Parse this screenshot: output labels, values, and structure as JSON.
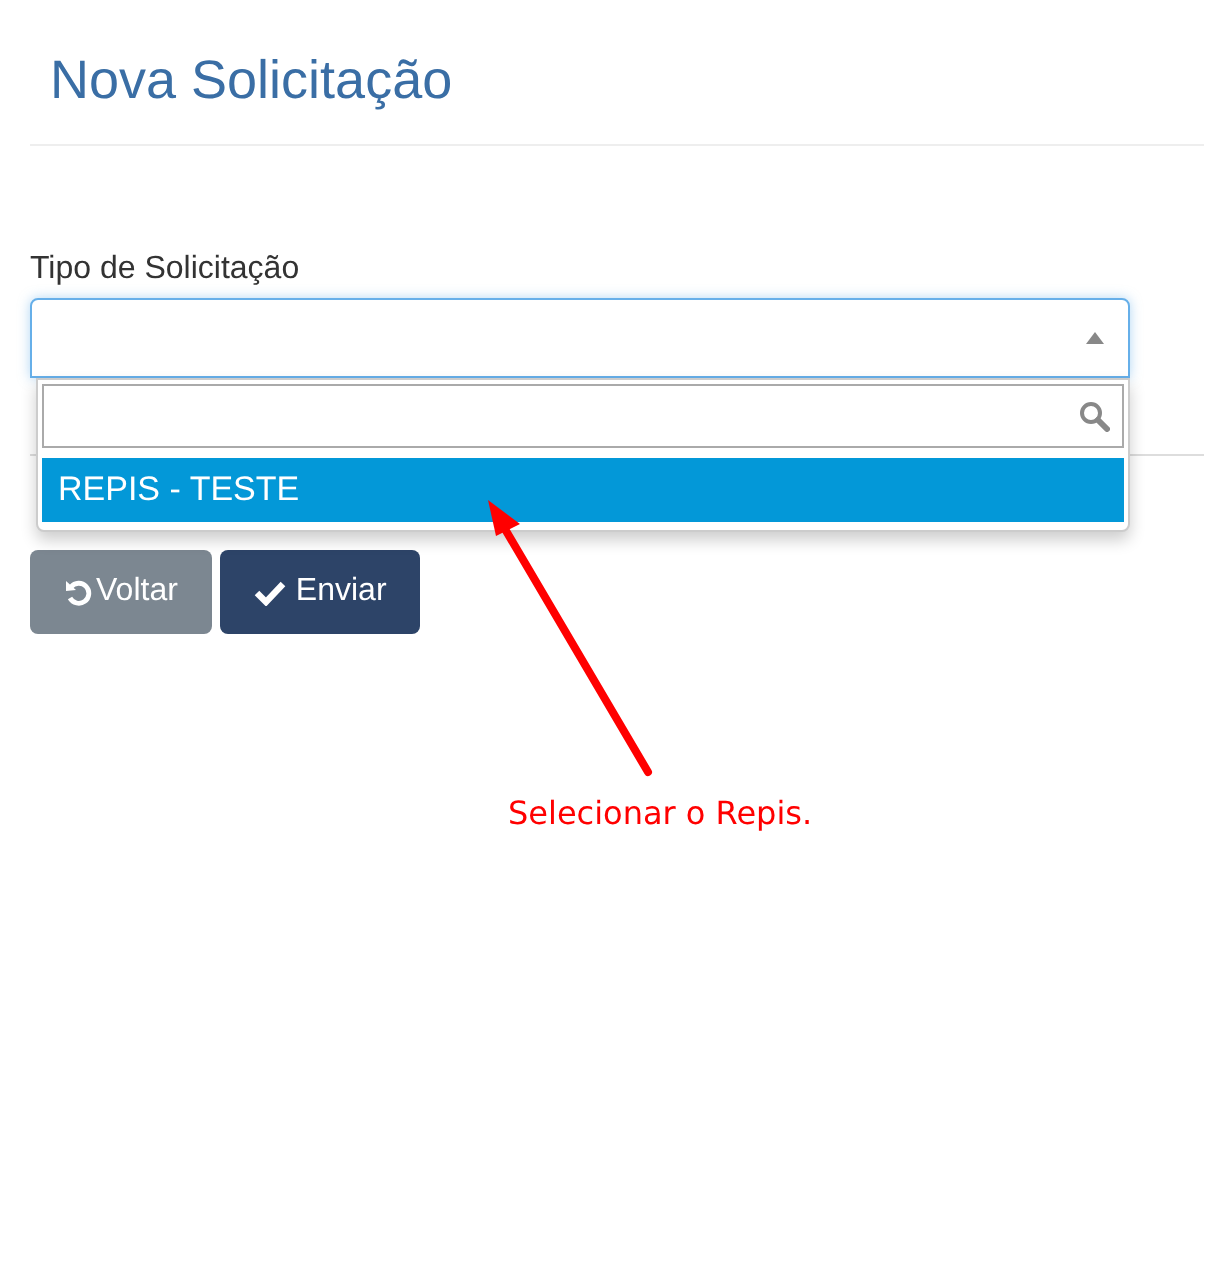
{
  "page_title": "Nova Solicitação",
  "form": {
    "label": "Tipo de Solicitação",
    "select": {
      "open": true,
      "options": [
        {
          "label": "REPIS - TESTE",
          "selected": true
        }
      ]
    }
  },
  "buttons": [
    {
      "kind": "back",
      "label": "Voltar"
    },
    {
      "kind": "submit",
      "label": "Enviar"
    }
  ],
  "annotation": {
    "text": "Selecionar o Repis."
  }
}
